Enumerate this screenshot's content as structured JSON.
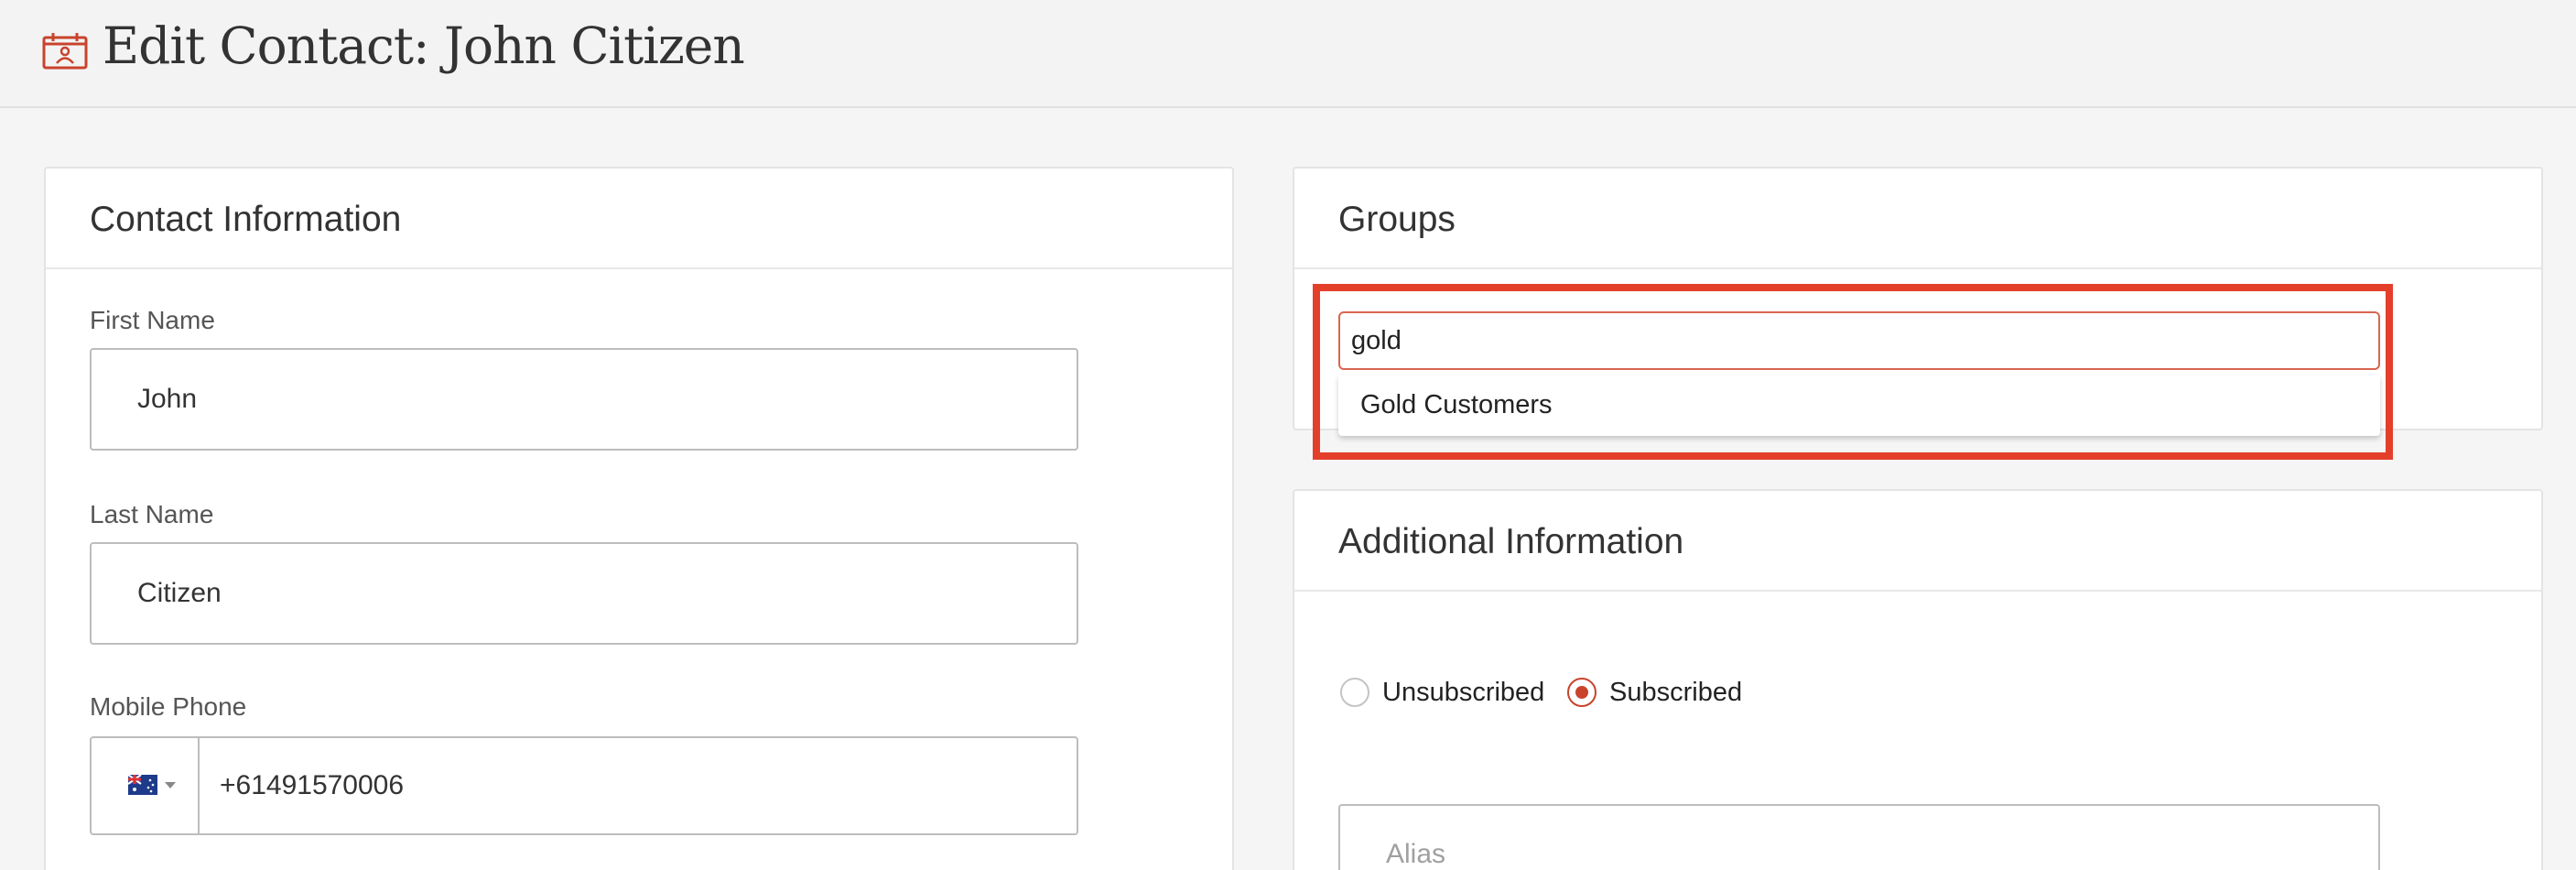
{
  "header": {
    "title": "Edit Contact: John Citizen",
    "icon": "contact-calendar-icon",
    "accent_color": "#c9432c"
  },
  "contact_info": {
    "title": "Contact Information",
    "first_name": {
      "label": "First Name",
      "value": "John"
    },
    "last_name": {
      "label": "Last Name",
      "value": "Citizen"
    },
    "mobile_phone": {
      "label": "Mobile Phone",
      "country_flag": "australia-flag-icon",
      "value": "+61491570006"
    }
  },
  "groups": {
    "title": "Groups",
    "search_value": "gold",
    "suggestions": [
      "Gold Customers"
    ],
    "highlight_color": "#e43f2a"
  },
  "additional_info": {
    "title": "Additional Information",
    "subscription": {
      "options": [
        "Unsubscribed",
        "Subscribed"
      ],
      "selected": "Subscribed"
    },
    "alias": {
      "placeholder": "Alias",
      "value": ""
    }
  }
}
